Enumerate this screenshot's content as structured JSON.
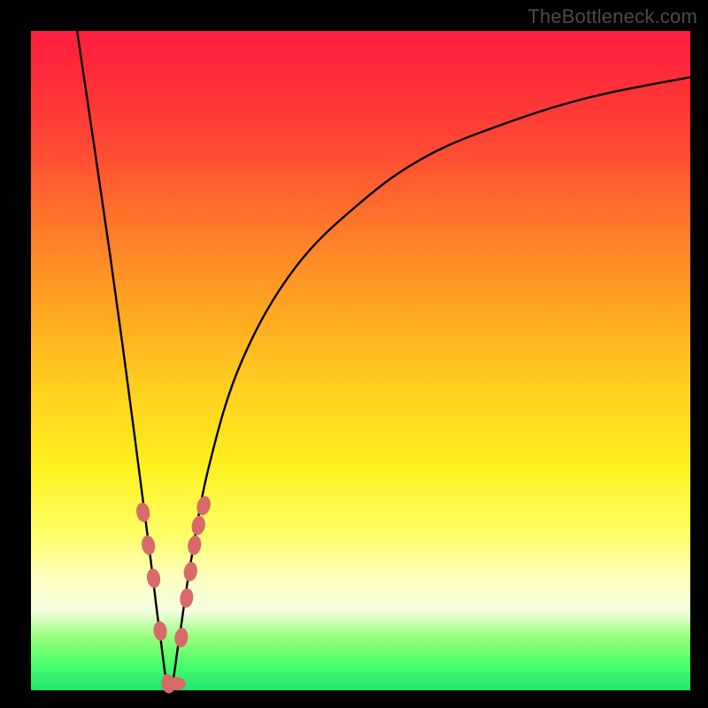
{
  "watermark": "TheBottleneck.com",
  "colors": {
    "frame": "#000000",
    "curve": "#000000",
    "bead": "#d86a6a",
    "gradient_stops": [
      "#ff1f3f",
      "#ffff65",
      "#20e472"
    ]
  },
  "chart_data": {
    "type": "line",
    "title": "",
    "xlabel": "",
    "ylabel": "",
    "xlim": [
      0,
      100
    ],
    "ylim": [
      0,
      100
    ],
    "description": "Bottleneck curve: y represents mismatch/bottleneck percentage (0 = balanced, 100 = severe). The curve dips to zero near x≈21 and rises steeply on both sides; the right branch rises more gradually than the left.",
    "optimum_x": 21,
    "series": [
      {
        "name": "bottleneck-curve",
        "x": [
          7,
          12,
          15,
          18,
          19.5,
          21,
          22.5,
          24,
          27,
          32,
          40,
          50,
          60,
          72,
          85,
          100
        ],
        "values": [
          100,
          66,
          44,
          21,
          9,
          0,
          8,
          18,
          34,
          50,
          64,
          74,
          81,
          86,
          90,
          93
        ]
      }
    ],
    "markers": {
      "name": "highlighted-points",
      "x": [
        17.0,
        17.8,
        18.6,
        19.6,
        20.8,
        22.0,
        22.8,
        23.6,
        24.2,
        24.8,
        25.4,
        26.2
      ],
      "values": [
        27,
        22,
        17,
        9,
        1,
        1,
        8,
        14,
        18,
        22,
        25,
        28
      ]
    }
  }
}
